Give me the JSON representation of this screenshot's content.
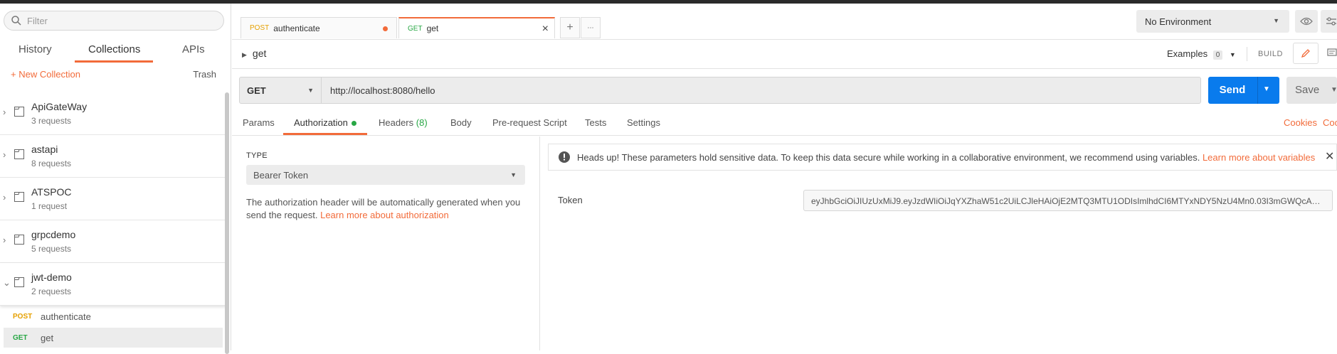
{
  "sidebar": {
    "filter_placeholder": "Filter",
    "tabs": [
      "History",
      "Collections",
      "APIs"
    ],
    "new_collection": "New Collection",
    "trash": "Trash",
    "collections": [
      {
        "name": "ApiGateWay",
        "count": "3 requests"
      },
      {
        "name": "astapi",
        "count": "8 requests"
      },
      {
        "name": "ATSPOC",
        "count": "1 request"
      },
      {
        "name": "grpcdemo",
        "count": "5 requests"
      },
      {
        "name": "jwt-demo",
        "count": "2 requests"
      }
    ],
    "requests": [
      {
        "method": "POST",
        "name": "authenticate"
      },
      {
        "method": "GET",
        "name": "get"
      }
    ]
  },
  "tabs": [
    {
      "method": "POST",
      "name": "authenticate"
    },
    {
      "method": "GET",
      "name": "get"
    }
  ],
  "tab_add": "+",
  "tab_more": "∙∙∙",
  "environment": {
    "selected": "No Environment"
  },
  "request": {
    "title": "get",
    "examples_label": "Examples",
    "examples_count": "0",
    "build_label": "BUILD",
    "method": "GET",
    "url": "http://localhost:8080/hello",
    "send_label": "Send",
    "save_label": "Save"
  },
  "request_tabs": {
    "params": "Params",
    "authorization": "Authorization",
    "headers": "Headers",
    "headers_count": "(8)",
    "body": "Body",
    "prerequest": "Pre-request Script",
    "tests": "Tests",
    "settings": "Settings",
    "cookies": "Cookies",
    "code": "Coc"
  },
  "auth": {
    "type_label": "TYPE",
    "type_value": "Bearer Token",
    "desc": "The authorization header will be automatically generated when you send the request.",
    "desc_link": "Learn more about authorization",
    "info_text": "Heads up! These parameters hold sensitive data. To keep this data secure while working in a collaborative environment, we recommend using variables.",
    "info_link": "Learn more about variables",
    "token_label": "Token",
    "token_value": "eyJhbGciOiJIUzUxMiJ9.eyJzdWIiOiJqYXZhaW51c2UiLCJleHAiOjE2MTQ3MTU1ODIsImlhdCI6MTYxNDY5NzU4Mn0.03I3mGWQcAoW ..."
  },
  "colors": {
    "accent": "#f26b3a",
    "send": "#097bed",
    "get": "#28a745",
    "post": "#e6a000"
  }
}
